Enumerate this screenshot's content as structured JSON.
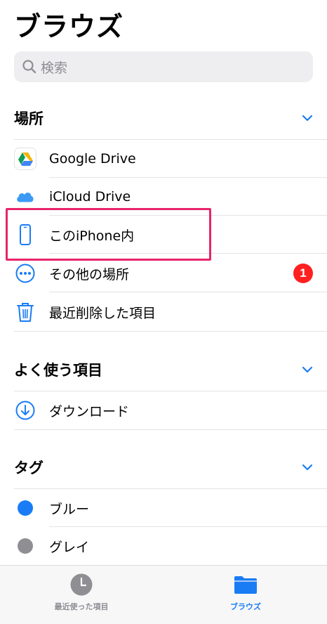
{
  "header": {
    "title": "ブラウズ"
  },
  "search": {
    "placeholder": "検索"
  },
  "sections": {
    "locations": {
      "title": "場所",
      "items": [
        {
          "label": "Google Drive",
          "icon": "google-drive-icon"
        },
        {
          "label": "iCloud Drive",
          "icon": "icloud-icon"
        },
        {
          "label": "このiPhone内",
          "icon": "iphone-icon"
        },
        {
          "label": "その他の場所",
          "icon": "more-icon",
          "badge": "1"
        },
        {
          "label": "最近削除した項目",
          "icon": "trash-icon"
        }
      ]
    },
    "favorites": {
      "title": "よく使う項目",
      "items": [
        {
          "label": "ダウンロード",
          "icon": "download-icon"
        }
      ]
    },
    "tags": {
      "title": "タグ",
      "items": [
        {
          "label": "ブルー",
          "color": "#1a7cf5"
        },
        {
          "label": "グレイ",
          "color": "#8e8e93"
        }
      ]
    }
  },
  "tabbar": {
    "recents_label": "最近使った項目",
    "browse_label": "ブラウズ"
  },
  "colors": {
    "accent": "#1a7cf5",
    "highlight": "#e8246a",
    "badge": "#ff2020"
  }
}
